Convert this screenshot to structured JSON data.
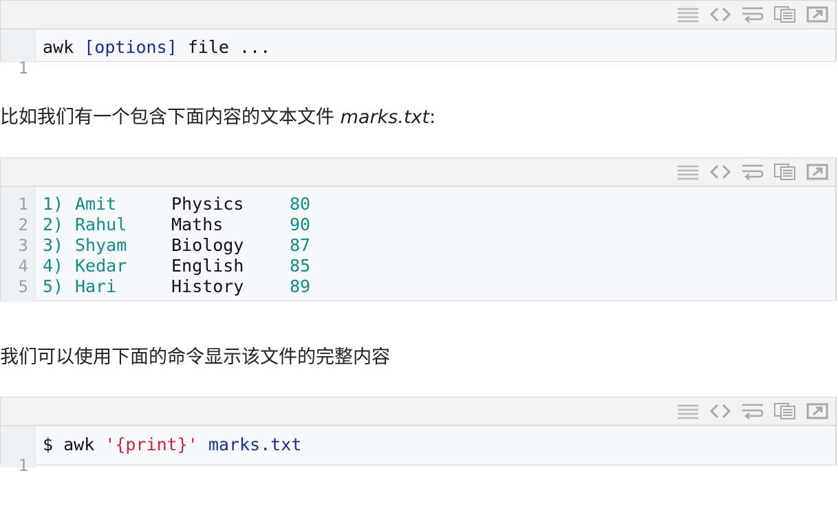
{
  "toolbar_icons": [
    "view-source-icon",
    "code-icon",
    "wrap-icon",
    "copy-icon",
    "popout-icon"
  ],
  "block1": {
    "lines": [
      {
        "num": "1",
        "parts": [
          {
            "text": "awk ",
            "cls": ""
          },
          {
            "text": "[options]",
            "cls": "kw"
          },
          {
            "text": " file ...",
            "cls": ""
          }
        ]
      }
    ]
  },
  "para1": {
    "text": "比如我们有一个包含下面内容的文本文件 ",
    "file": "marks.txt",
    "suffix": ":"
  },
  "block2": {
    "rows": [
      {
        "num": "1",
        "idx": "1)",
        "name": "Amit",
        "subject": "Physics",
        "score": "80"
      },
      {
        "num": "2",
        "idx": "2)",
        "name": "Rahul",
        "subject": "Maths",
        "score": "90"
      },
      {
        "num": "3",
        "idx": "3)",
        "name": "Shyam",
        "subject": "Biology",
        "score": "87"
      },
      {
        "num": "4",
        "idx": "4)",
        "name": "Kedar",
        "subject": "English",
        "score": "85"
      },
      {
        "num": "5",
        "idx": "5)",
        "name": "Hari",
        "subject": "History",
        "score": "89"
      }
    ]
  },
  "para2": {
    "text": "我们可以使用下面的命令显示该文件的完整内容"
  },
  "block3": {
    "lines": [
      {
        "num": "1",
        "parts": [
          {
            "text": "$ awk ",
            "cls": ""
          },
          {
            "text": "'{print}'",
            "cls": "str"
          },
          {
            "text": " ",
            "cls": ""
          },
          {
            "text": "marks.txt",
            "cls": "kw"
          }
        ]
      }
    ]
  }
}
